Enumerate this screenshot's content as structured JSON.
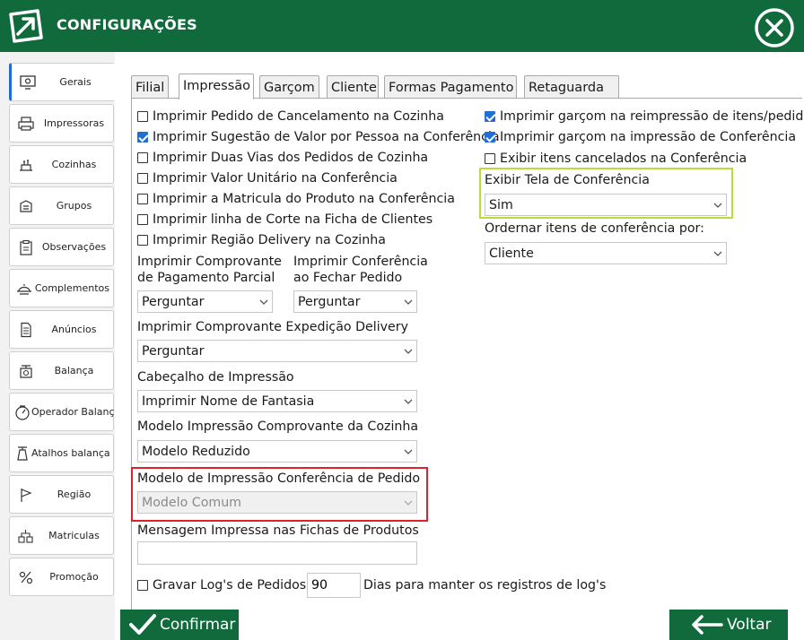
{
  "window": {
    "title": "CONFIGURAÇÕES"
  },
  "colors": {
    "brand": "#106a3c",
    "accent": "#1f6fd6",
    "highlight_red": "#e0202a",
    "highlight_green": "#b9dc3a"
  },
  "sidebar": {
    "items": [
      {
        "label": "Gerais",
        "icon": "gear-monitor-icon"
      },
      {
        "label": "Impressoras",
        "icon": "printer-icon"
      },
      {
        "label": "Cozinhas",
        "icon": "kitchen-icon"
      },
      {
        "label": "Grupos",
        "icon": "groups-icon"
      },
      {
        "label": "Observações",
        "icon": "clipboard-icon"
      },
      {
        "label": "Complementos",
        "icon": "dish-icon"
      },
      {
        "label": "Anúncios",
        "icon": "document-icon"
      },
      {
        "label": "Balança",
        "icon": "scale-icon"
      },
      {
        "label": "Operador Balança",
        "icon": "operator-scale-icon"
      },
      {
        "label": "Atalhos balança",
        "icon": "scale-shortcut-icon"
      },
      {
        "label": "Região",
        "icon": "flag-icon"
      },
      {
        "label": "Matriculas",
        "icon": "registration-icon"
      },
      {
        "label": "Promoção",
        "icon": "promotion-icon"
      }
    ]
  },
  "tabs": [
    "Filial",
    "Impressão",
    "Garçom",
    "Cliente",
    "Formas Pagamento",
    "Retaguarda"
  ],
  "left": {
    "checks": [
      {
        "label": "Imprimir Pedido de Cancelamento na Cozinha",
        "checked": false
      },
      {
        "label": "Imprimir Sugestão de Valor por Pessoa na Conferência",
        "checked": true
      },
      {
        "label": "Imprimir Duas Vias dos Pedidos de Cozinha",
        "checked": false
      },
      {
        "label": "Imprimir Valor Unitário na Conferência",
        "checked": false
      },
      {
        "label": "Imprimir a Matricula do Produto na Conferência",
        "checked": false
      },
      {
        "label": "Imprimir linha de Corte na Ficha de Clientes",
        "checked": false
      },
      {
        "label": "Imprimir Região Delivery na Cozinha",
        "checked": false
      }
    ],
    "comp_parcial": {
      "label1": "Imprimir Comprovante",
      "label2": "de Pagamento Parcial",
      "value": "Perguntar"
    },
    "conf_fechar": {
      "label1": "Imprimir Conferência",
      "label2": "ao Fechar Pedido",
      "value": "Perguntar"
    },
    "expedicao": {
      "label": "Imprimir Comprovante Expedição Delivery",
      "value": "Perguntar"
    },
    "cabecalho": {
      "label": "Cabeçalho de Impressão",
      "value": "Imprimir Nome de Fantasia"
    },
    "modelo_cozinha": {
      "label": "Modelo Impressão Comprovante da Cozinha",
      "value": "Modelo Reduzido"
    },
    "modelo_conf": {
      "label": "Modelo de Impressão Conferência de Pedido",
      "value": "Modelo Comum"
    },
    "mensagem": {
      "label": "Mensagem Impressa nas Fichas de Produtos",
      "value": ""
    },
    "log": {
      "label": "Gravar Log's de Pedidos",
      "checked": false,
      "days": "90",
      "days_label": "Dias para manter os registros de log's"
    }
  },
  "right": {
    "checks": [
      {
        "label": "Imprimir garçom na reimpressão de itens/pedido",
        "checked": true
      },
      {
        "label": "Imprimir garçom na impressão de Conferência",
        "checked": true
      },
      {
        "label": "Exibir itens cancelados na Conferência",
        "checked": false
      }
    ],
    "exibir_tela": {
      "label": "Exibir Tela de Conferência",
      "value": "Sim"
    },
    "ordenar": {
      "label": "Ordernar itens de conferência por:",
      "value": "Cliente"
    }
  },
  "footer": {
    "confirm_label": "Confirmar",
    "back_label": "Voltar"
  }
}
